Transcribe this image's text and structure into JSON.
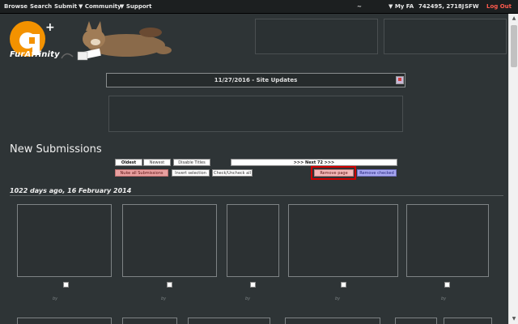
{
  "nav": {
    "browse": "Browse",
    "search": "Search",
    "submit": "Submit",
    "community": "▼ Community",
    "support": "▼ Support",
    "tilde": "~",
    "my_fa": "▼ My FA",
    "counts": "742495, 2718J",
    "sfw": "SFW",
    "logout": "Log Out"
  },
  "logo": {
    "text": "FurAffinity"
  },
  "site_update": {
    "text": "11/27/2016 - Site Updates"
  },
  "page_title": "New Submissions",
  "buttons": {
    "oldest": "Oldest",
    "newest": "Newest",
    "disable_titles": "Disable Titles",
    "next": ">>> Next 72 >>>",
    "nuke_all": "Nuke all Submissions",
    "invert_selection": "Invert selection",
    "check_uncheck": "Check/Uncheck all",
    "remove_page": "Remove page",
    "remove_checked": "Remove checked"
  },
  "day_header": "1022 days ago, 16 February 2014",
  "submissions": [
    {
      "by": "by"
    },
    {
      "by": "by"
    },
    {
      "by": "by"
    },
    {
      "by": "by"
    },
    {
      "by": "by"
    }
  ],
  "colors": {
    "background": "#2e3436",
    "nav_bg": "#1c1f20",
    "logout": "#ff5a4d",
    "remove_page_highlight": "#d00000",
    "nuke_button": "#e8a0a0",
    "remove_checked_button": "#a8a8f0"
  }
}
